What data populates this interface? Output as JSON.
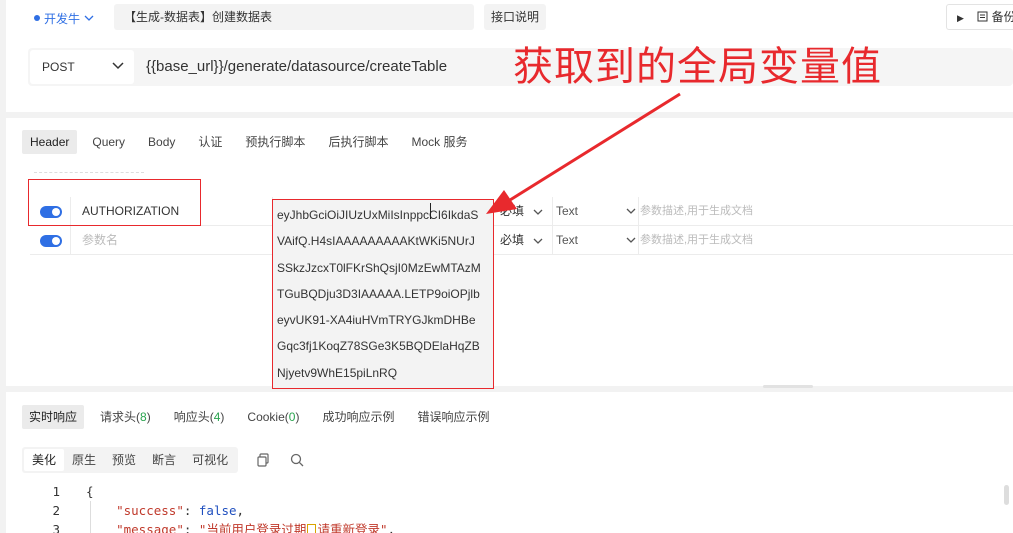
{
  "top": {
    "env_label": "开发牛",
    "api_name": "【生成-数据表】创建数据表",
    "doc_button": "接口说明",
    "backup_button": "备份"
  },
  "request": {
    "method": "POST",
    "url": "{{base_url}}/generate/datasource/createTable"
  },
  "annotation": {
    "text": "获取到的全局变量值",
    "color": "#e8292d"
  },
  "tabs": [
    "Header",
    "Query",
    "Body",
    "认证",
    "预执行脚本",
    "后执行脚本",
    "Mock 服务"
  ],
  "params": {
    "row1": {
      "name": "AUTHORIZATION",
      "required": "必填",
      "type": "Text",
      "desc_placeholder": "参数描述,用于生成文档"
    },
    "row2": {
      "name_placeholder": "参数名",
      "required": "必填",
      "type": "Text",
      "desc_placeholder": "参数描述,用于生成文档"
    },
    "value_lines": [
      "eyJhbGciOiJIUzUxMiIsInppcCI6IkdaS",
      "VAifQ.H4sIAAAAAAAAAKtWKi5NUrJ",
      "SSkzJzcxT0lFKrShQsjI0MzEwMTAzM",
      "TGuBQDju3D3IAAAAA.LETP9oiOPjlb",
      "eyvUK91-XA4iuHVmTRYGJkmDHBe",
      "Gqc3fj1KoqZ78SGe3K5BQDElaHqZB",
      "Njyetv9WhE15piLnRQ"
    ]
  },
  "response": {
    "tabs": [
      {
        "label": "实时响应"
      },
      {
        "label": "请求头",
        "count": "8"
      },
      {
        "label": "响应头",
        "count": "4"
      },
      {
        "label": "Cookie",
        "count": "0"
      },
      {
        "label": "成功响应示例"
      },
      {
        "label": "错误响应示例"
      }
    ],
    "view_tabs": [
      "美化",
      "原生",
      "预览",
      "断言",
      "可视化"
    ],
    "code": {
      "line_numbers": [
        "1",
        "2",
        "3"
      ],
      "open_brace": "{",
      "success_key": "\"success\"",
      "success_value": "false",
      "message_key": "\"message\"",
      "message_value_a": "\"当前用户登录过期",
      "message_value_b": "请重新登录\""
    }
  },
  "icons": {
    "env_chevron": "chevron-down-icon",
    "method_chevron": "chevron-down-icon",
    "play": "play-icon",
    "backup": "backup-icon",
    "copy": "copy-icon",
    "search": "search-icon",
    "toggle": "toggle-icon"
  }
}
